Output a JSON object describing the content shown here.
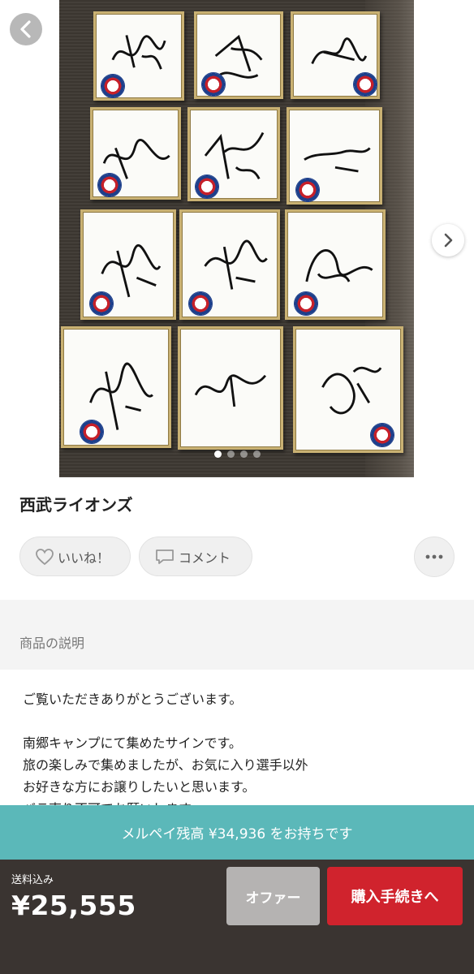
{
  "photo": {
    "page_count": 4,
    "active_index": 0
  },
  "product": {
    "title": "西武ライオンズ"
  },
  "actions": {
    "like_label": "いいね！",
    "comment_label": "コメント"
  },
  "description": {
    "section_label": "商品の説明",
    "lines": [
      "ご覧いただきありがとうございます。",
      "",
      "南郷キャンプにて集めたサインです。",
      "旅の楽しみで集めましたが、お気に入り選手以外",
      "お好きな方にお譲りしたいと思います。",
      "バラ売り不可でお願いします。"
    ]
  },
  "balance": {
    "text": "メルペイ残高 ¥34,936 をお持ちです"
  },
  "purchase": {
    "shipping_label": "送料込み",
    "price": "¥25,555",
    "offer_label": "オファー",
    "buy_label": "購入手続きへ"
  },
  "colors": {
    "balance_bar": "#5bb8b9",
    "buy_button": "#d0232d",
    "offer_button": "#b5b3b2",
    "bottom_bar": "#3a3431"
  },
  "icons": {
    "back": "chevron-left-icon",
    "next": "chevron-right-icon",
    "like": "heart-outline-icon",
    "comment": "speech-bubble-icon",
    "more": "more-horizontal-icon"
  }
}
